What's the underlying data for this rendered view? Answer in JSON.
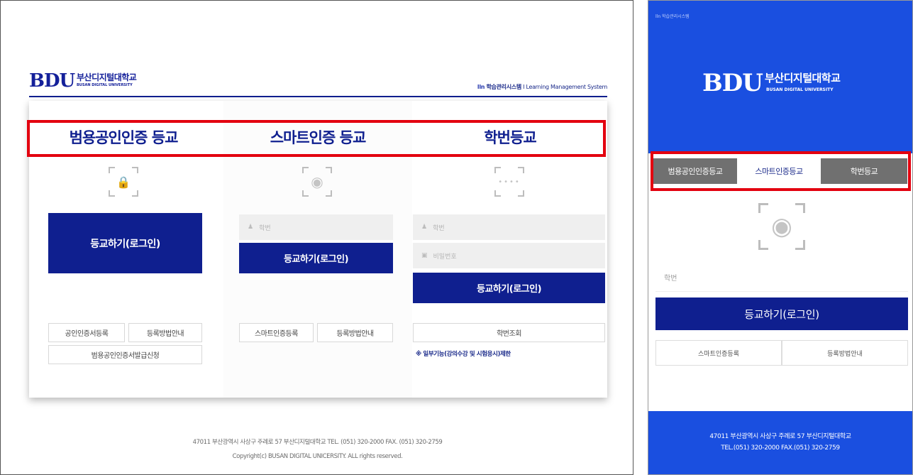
{
  "desktop": {
    "header": {
      "logo_mark": "BDU",
      "logo_kr": "부산디지털대학교",
      "logo_en": "BUSAN DIGITAL UNIVERSITY",
      "lms_mark": "lln",
      "lms_kr": "학습관리시스템",
      "lms_sep": "I",
      "lms_en": "Learning Management System"
    },
    "columns": [
      {
        "title": "범용공인인증 등교",
        "scan_icon": "lock-icon",
        "login_label": "등교하기(로그인)",
        "buttons": [
          "공인인증서등록",
          "등록방법안내",
          "범용공인인증서발급신청"
        ]
      },
      {
        "title": "스마트인증 등교",
        "scan_icon": "fingerprint-icon",
        "id_placeholder": "학번",
        "login_label": "등교하기(로그인)",
        "buttons": [
          "스마트인증등록",
          "등록방법안내"
        ]
      },
      {
        "title": "학번등교",
        "scan_icon": "password-dots-icon",
        "id_placeholder": "학번",
        "pw_placeholder": "비밀번호",
        "login_label": "등교하기(로그인)",
        "buttons": [
          "학번조회"
        ],
        "note": "※ 일부기능(강의수강 및 시험응시)제한"
      }
    ],
    "footer": {
      "address": "47011 부산광역시 사상구 주례로 57 부산디지털대학교 TEL. (051) 320-2000 FAX. (051) 320-2759",
      "copyright": "Copyright(c) BUSAN DIGITAL UNICERSITY. ALL rights reserved."
    }
  },
  "mobile": {
    "top_small": "lln 학습관리시스템",
    "logo_mark": "BDU",
    "logo_kr": "부산디지털대학교",
    "logo_en": "BUSAN DIGITAL UNIVERSITY",
    "tabs": [
      {
        "label": "범용공인인증등교",
        "active": false
      },
      {
        "label": "스마트인증등교",
        "active": true
      },
      {
        "label": "학번등교",
        "active": false
      }
    ],
    "id_placeholder": "학번",
    "login_label": "등교하기(로그인)",
    "buttons": [
      "스마트인증등록",
      "등록방법안내"
    ],
    "footer": {
      "line1": "47011 부산광역시 사상구 주례로 57 부산디지털대학교",
      "line2": "TEL.(051) 320-2000 FAX.(051) 320-2759"
    }
  },
  "colors": {
    "navy": "#0f1f8f",
    "mobile_blue": "#1a4fe0",
    "highlight_red": "#e3000f",
    "tab_gray": "#707070"
  }
}
